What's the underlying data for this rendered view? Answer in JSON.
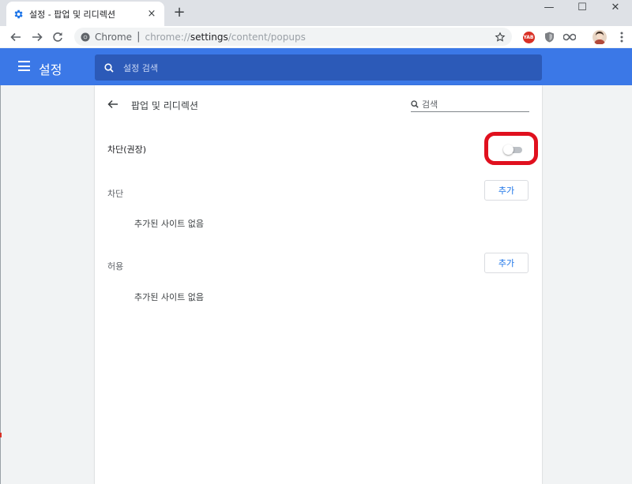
{
  "tab": {
    "title": "설정 - 팝업 및 리디렉션",
    "close": "×"
  },
  "newtab": "+",
  "window": {
    "minimize": "—",
    "maximize": "☐",
    "close": "✕"
  },
  "omnibox": {
    "chrome_label": "Chrome",
    "separator": "|",
    "url_prefix": "chrome://",
    "url_host": "settings",
    "url_path": "/content/popups"
  },
  "extensions": {
    "yab_label": "YAB"
  },
  "header": {
    "title": "설정",
    "search_placeholder": "설정 검색"
  },
  "subpage": {
    "title": "팝업 및 리디렉션",
    "search_placeholder": "검색",
    "main_toggle_label": "차단(권장)",
    "main_toggle_on": false,
    "block": {
      "label": "차단",
      "add_button": "추가",
      "empty_text": "추가된 사이트 없음"
    },
    "allow": {
      "label": "허용",
      "add_button": "추가",
      "empty_text": "추가된 사이트 없음"
    }
  },
  "colors": {
    "header_blue": "#3b78e7",
    "search_blue": "#2c5ab8",
    "highlight_red": "#e0101e",
    "accent": "#1a73e8"
  }
}
